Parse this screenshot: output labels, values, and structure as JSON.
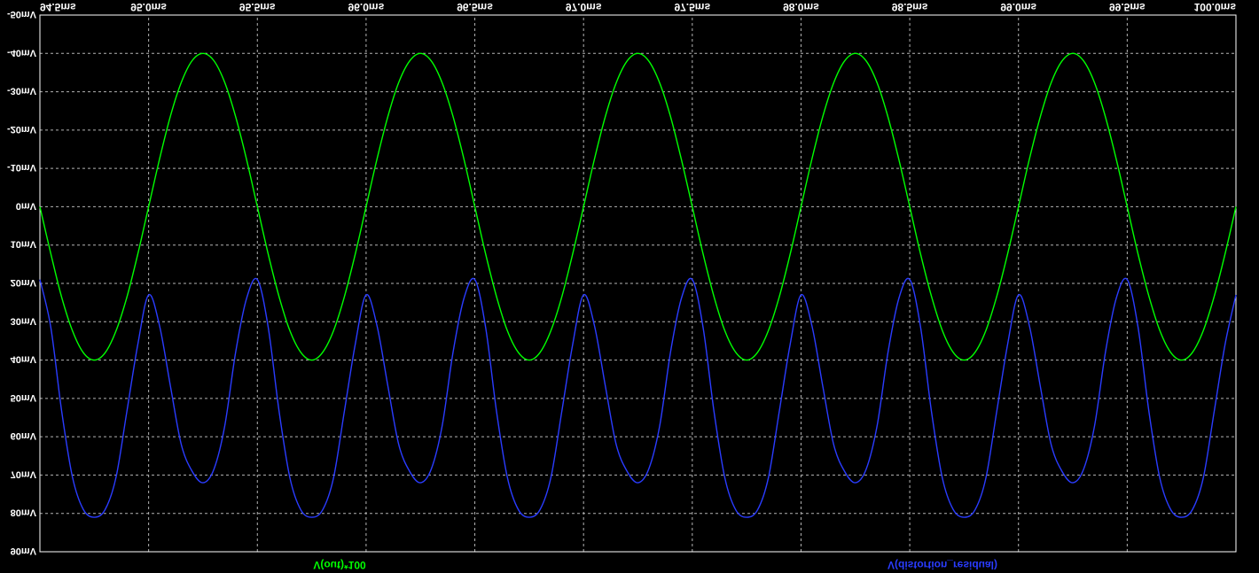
{
  "colors": {
    "background": "#000000",
    "grid": "#b4b4b4",
    "frame": "#ffffff",
    "tick_text": "#ffffff"
  },
  "display": {
    "vertical_mirror": true
  },
  "chart_data": {
    "type": "line",
    "title": "",
    "xlabel": "",
    "ylabel": "",
    "x_unit": "ms",
    "y_unit": "mV",
    "xlim": [
      94.5,
      100.0
    ],
    "ylim": [
      -50,
      90
    ],
    "grid": true,
    "x_ticks": [
      "94.5ms",
      "95.0ms",
      "95.5ms",
      "96.0ms",
      "96.5ms",
      "97.0ms",
      "97.5ms",
      "98.0ms",
      "98.5ms",
      "99.0ms",
      "99.5ms",
      "100.0ms"
    ],
    "y_ticks": [
      "-50mV",
      "-40mV",
      "-30mV",
      "-20mV",
      "-10mV",
      "0mV",
      "10mV",
      "20mV",
      "30mV",
      "40mV",
      "50mV",
      "60mV",
      "70mV",
      "80mV",
      "90mV"
    ],
    "x": [
      94.5,
      94.55,
      94.6,
      94.65,
      94.7,
      94.75,
      94.8,
      94.85,
      94.9,
      94.95,
      95.0,
      95.05,
      95.1,
      95.15,
      95.2,
      95.25,
      95.3,
      95.35,
      95.4,
      95.45,
      95.5,
      95.55,
      95.6,
      95.65,
      95.7,
      95.75,
      95.8,
      95.85,
      95.9,
      95.95,
      96.0,
      96.05,
      96.1,
      96.15,
      96.2,
      96.25,
      96.3,
      96.35,
      96.4,
      96.45,
      96.5,
      96.55,
      96.6,
      96.65,
      96.7,
      96.75,
      96.8,
      96.85,
      96.9,
      96.95,
      97.0,
      97.05,
      97.1,
      97.15,
      97.2,
      97.25,
      97.3,
      97.35,
      97.4,
      97.45,
      97.5,
      97.55,
      97.6,
      97.65,
      97.7,
      97.75,
      97.8,
      97.85,
      97.9,
      97.95,
      98.0,
      98.05,
      98.1,
      98.15,
      98.2,
      98.25,
      98.3,
      98.35,
      98.4,
      98.45,
      98.5,
      98.55,
      98.6,
      98.65,
      98.7,
      98.75,
      98.8,
      98.85,
      98.9,
      98.95,
      99.0,
      99.05,
      99.1,
      99.15,
      99.2,
      99.25,
      99.3,
      99.35,
      99.4,
      99.45,
      99.5,
      99.55,
      99.6,
      99.65,
      99.7,
      99.75,
      99.8,
      99.85,
      99.9,
      99.95,
      100.0
    ],
    "series": [
      {
        "name": "V(out)*100",
        "color": "#00ff00",
        "legend_label": "V(out)*100",
        "values": [
          0.0,
          12.2,
          23.6,
          32.4,
          38.1,
          40.0,
          38.1,
          32.4,
          23.6,
          12.4,
          0.0,
          -12.4,
          -23.6,
          -32.4,
          -38.1,
          -40.0,
          -38.1,
          -32.4,
          -23.5,
          -12.4,
          0.0,
          12.4,
          23.5,
          32.4,
          38.0,
          40.0,
          38.0,
          32.4,
          23.5,
          12.4,
          0.0,
          -12.4,
          -23.5,
          -32.4,
          -38.0,
          -40.0,
          -38.0,
          -32.3,
          -23.5,
          -12.4,
          0.0,
          12.4,
          23.5,
          32.4,
          38.0,
          40.0,
          38.0,
          32.3,
          23.5,
          12.3,
          0.0,
          -12.4,
          -23.5,
          -32.3,
          -38.0,
          -40.0,
          -38.0,
          -32.3,
          -23.5,
          -12.3,
          0.0,
          12.4,
          23.5,
          32.4,
          38.0,
          40.0,
          38.0,
          32.3,
          23.5,
          12.4,
          0.0,
          -12.4,
          -23.5,
          -32.3,
          -38.0,
          -40.0,
          -38.0,
          -32.3,
          -23.4,
          -12.3,
          0.0,
          12.4,
          23.4,
          32.3,
          38.0,
          40.0,
          38.0,
          32.3,
          23.4,
          12.3,
          0.0,
          -12.4,
          -23.4,
          -32.3,
          -38.0,
          -40.0,
          -38.0,
          -32.3,
          -23.4,
          -12.3,
          0.0,
          12.4,
          23.4,
          32.3,
          38.0,
          40.0,
          38.0,
          32.3,
          23.4,
          12.3,
          0.0
        ]
      },
      {
        "name": "V(distortion_residual)",
        "color": "#2a3cff",
        "legend_label": "V(distortion_residual)",
        "values": [
          19.0,
          31.4,
          53.3,
          70.6,
          79.0,
          81.0,
          79.0,
          70.6,
          53.4,
          36.0,
          23.0,
          31.0,
          46.7,
          62.0,
          69.0,
          72.0,
          68.5,
          57.2,
          38.0,
          24.0,
          19.0,
          31.5,
          53.4,
          70.8,
          79.1,
          81.0,
          79.1,
          70.8,
          53.4,
          35.9,
          23.0,
          31.0,
          46.7,
          62.0,
          69.0,
          72.0,
          68.4,
          57.1,
          37.9,
          23.9,
          19.0,
          31.6,
          53.5,
          70.7,
          79.0,
          81.0,
          79.0,
          70.6,
          53.4,
          35.9,
          23.0,
          31.0,
          46.7,
          62.0,
          69.0,
          72.0,
          68.4,
          57.2,
          37.9,
          23.9,
          19.0,
          31.6,
          53.5,
          70.8,
          79.1,
          81.0,
          79.1,
          70.7,
          53.4,
          35.9,
          23.0,
          31.0,
          46.8,
          62.0,
          69.0,
          72.0,
          68.4,
          57.1,
          38.0,
          23.9,
          19.0,
          31.5,
          53.5,
          70.8,
          79.0,
          81.0,
          79.1,
          70.8,
          53.4,
          35.9,
          23.0,
          31.0,
          46.7,
          62.0,
          69.0,
          72.0,
          68.4,
          57.1,
          37.9,
          23.8,
          19.0,
          31.5,
          53.5,
          70.8,
          79.0,
          81.0,
          79.0,
          70.7,
          53.4,
          35.9,
          23.0
        ]
      }
    ]
  }
}
